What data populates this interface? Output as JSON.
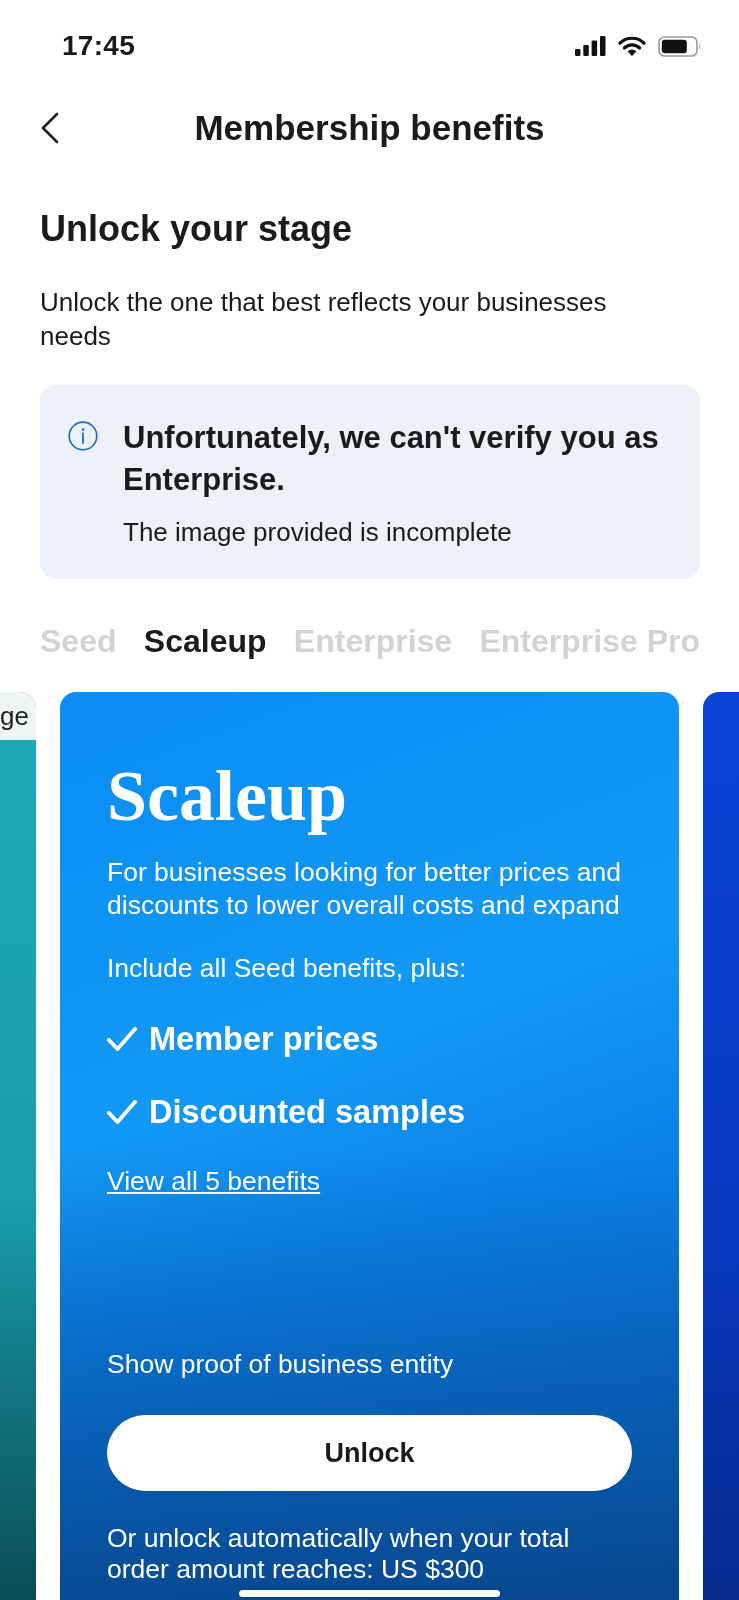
{
  "status_bar": {
    "time": "17:45"
  },
  "header": {
    "title": "Membership benefits"
  },
  "intro": {
    "heading": "Unlock your stage",
    "text": "Unlock the one that best reflects your businesses needs"
  },
  "alert": {
    "title": "Unfortunately, we can't verify you as Enterprise.",
    "message": "The image provided is incomplete"
  },
  "tabs": [
    {
      "label": "Seed",
      "selected": false
    },
    {
      "label": "Scaleup",
      "selected": true
    },
    {
      "label": "Enterprise",
      "selected": false
    },
    {
      "label": "Enterprise Pro",
      "selected": false
    }
  ],
  "cards": [
    {
      "kind": "previous",
      "badge": "ge"
    },
    {
      "kind": "current",
      "name": "Scaleup",
      "description": "For businesses looking for better prices and discounts to lower overall costs and expand",
      "benefits_intro": "Include all Seed benefits, plus:",
      "benefits": [
        "Member prices",
        "Discounted samples"
      ],
      "link": "View all 5 benefits",
      "requirement": "Show proof of business entity",
      "button": "Unlock",
      "note": "Or unlock automatically when your total order amount reaches: US $300"
    },
    {
      "kind": "next"
    }
  ]
}
